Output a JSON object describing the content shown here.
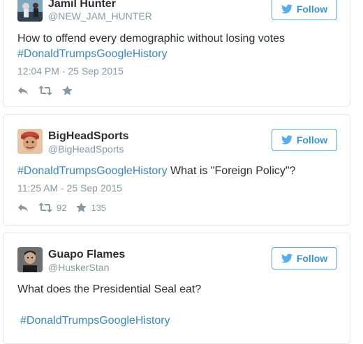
{
  "tweets": [
    {
      "name": "Jamil Hunter",
      "handle": "@NEW_JAM_HUNTER",
      "follow_label": "Follow",
      "text": "How to offend every demographic without losing votes",
      "hashtag": "#DonaldTrumpsGoogleHistory",
      "timestamp": "12:04 PM - 25 Sep 2015",
      "icons": [
        "reply-icon",
        "retweet-icon",
        "favorite-icon"
      ]
    },
    {
      "name": "BigHeadSports",
      "handle": "@BigHeadSports",
      "follow_label": "Follow",
      "hashtag": "#DonaldTrumpsGoogleHistory",
      "text": " What is \"Foreign Policy\"?",
      "timestamp": "11:25 AM - 25 Sep 2015",
      "retweet_count": "92",
      "favorite_count": "135"
    },
    {
      "name": "Guapo Flames",
      "handle": "@HuskerStan",
      "follow_label": "Follow",
      "text": "What does the Presidential Seal eat?",
      "hashtag": "#DonaldTrumpsGoogleHistory"
    }
  ],
  "colors": {
    "accent": "#55acee",
    "link": "#3b88c3",
    "muted": "#8899a6",
    "border": "#e1e8ed"
  }
}
